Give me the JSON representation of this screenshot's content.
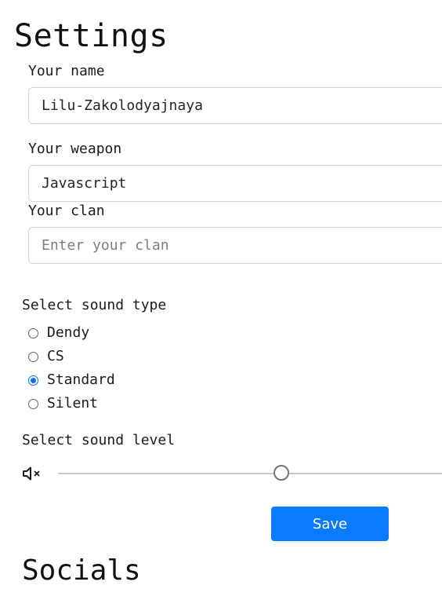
{
  "page": {
    "title": "Settings"
  },
  "form": {
    "name_label": "Your name",
    "name_value": "Lilu-Zakolodyajnaya",
    "weapon_label": "Your weapon",
    "weapon_value": "Javascript",
    "clan_label": "Your clan",
    "clan_value": "",
    "clan_placeholder": "Enter your clan"
  },
  "sound": {
    "type_label": "Select sound type",
    "options": [
      {
        "label": "Dendy",
        "checked": false
      },
      {
        "label": "CS",
        "checked": false
      },
      {
        "label": "Standard",
        "checked": true
      },
      {
        "label": "Silent",
        "checked": false
      }
    ],
    "level_label": "Select sound level",
    "level_icon": "volume-mute-icon",
    "level_value": 0.57
  },
  "actions": {
    "save_label": "Save"
  },
  "socials": {
    "title": "Socials"
  },
  "colors": {
    "accent": "#0a7aff",
    "radio_checked": "#0d6efd",
    "input_border": "#ced4da"
  }
}
